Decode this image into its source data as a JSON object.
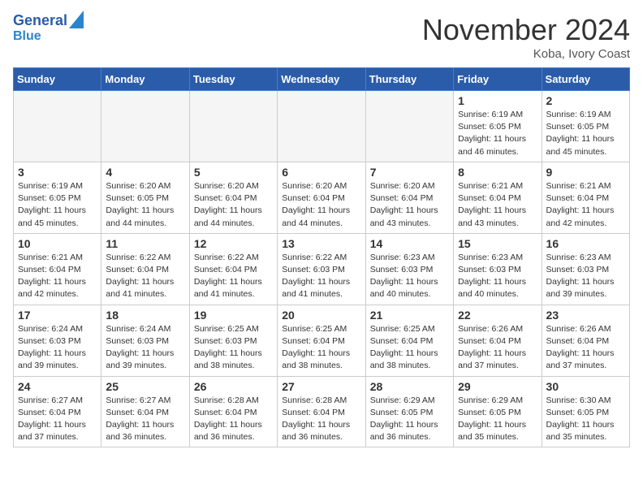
{
  "header": {
    "logo_line1": "General",
    "logo_line2": "Blue",
    "month": "November 2024",
    "location": "Koba, Ivory Coast"
  },
  "weekdays": [
    "Sunday",
    "Monday",
    "Tuesday",
    "Wednesday",
    "Thursday",
    "Friday",
    "Saturday"
  ],
  "weeks": [
    [
      {
        "day": "",
        "info": ""
      },
      {
        "day": "",
        "info": ""
      },
      {
        "day": "",
        "info": ""
      },
      {
        "day": "",
        "info": ""
      },
      {
        "day": "",
        "info": ""
      },
      {
        "day": "1",
        "info": "Sunrise: 6:19 AM\nSunset: 6:05 PM\nDaylight: 11 hours\nand 46 minutes."
      },
      {
        "day": "2",
        "info": "Sunrise: 6:19 AM\nSunset: 6:05 PM\nDaylight: 11 hours\nand 45 minutes."
      }
    ],
    [
      {
        "day": "3",
        "info": "Sunrise: 6:19 AM\nSunset: 6:05 PM\nDaylight: 11 hours\nand 45 minutes."
      },
      {
        "day": "4",
        "info": "Sunrise: 6:20 AM\nSunset: 6:05 PM\nDaylight: 11 hours\nand 44 minutes."
      },
      {
        "day": "5",
        "info": "Sunrise: 6:20 AM\nSunset: 6:04 PM\nDaylight: 11 hours\nand 44 minutes."
      },
      {
        "day": "6",
        "info": "Sunrise: 6:20 AM\nSunset: 6:04 PM\nDaylight: 11 hours\nand 44 minutes."
      },
      {
        "day": "7",
        "info": "Sunrise: 6:20 AM\nSunset: 6:04 PM\nDaylight: 11 hours\nand 43 minutes."
      },
      {
        "day": "8",
        "info": "Sunrise: 6:21 AM\nSunset: 6:04 PM\nDaylight: 11 hours\nand 43 minutes."
      },
      {
        "day": "9",
        "info": "Sunrise: 6:21 AM\nSunset: 6:04 PM\nDaylight: 11 hours\nand 42 minutes."
      }
    ],
    [
      {
        "day": "10",
        "info": "Sunrise: 6:21 AM\nSunset: 6:04 PM\nDaylight: 11 hours\nand 42 minutes."
      },
      {
        "day": "11",
        "info": "Sunrise: 6:22 AM\nSunset: 6:04 PM\nDaylight: 11 hours\nand 41 minutes."
      },
      {
        "day": "12",
        "info": "Sunrise: 6:22 AM\nSunset: 6:04 PM\nDaylight: 11 hours\nand 41 minutes."
      },
      {
        "day": "13",
        "info": "Sunrise: 6:22 AM\nSunset: 6:03 PM\nDaylight: 11 hours\nand 41 minutes."
      },
      {
        "day": "14",
        "info": "Sunrise: 6:23 AM\nSunset: 6:03 PM\nDaylight: 11 hours\nand 40 minutes."
      },
      {
        "day": "15",
        "info": "Sunrise: 6:23 AM\nSunset: 6:03 PM\nDaylight: 11 hours\nand 40 minutes."
      },
      {
        "day": "16",
        "info": "Sunrise: 6:23 AM\nSunset: 6:03 PM\nDaylight: 11 hours\nand 39 minutes."
      }
    ],
    [
      {
        "day": "17",
        "info": "Sunrise: 6:24 AM\nSunset: 6:03 PM\nDaylight: 11 hours\nand 39 minutes."
      },
      {
        "day": "18",
        "info": "Sunrise: 6:24 AM\nSunset: 6:03 PM\nDaylight: 11 hours\nand 39 minutes."
      },
      {
        "day": "19",
        "info": "Sunrise: 6:25 AM\nSunset: 6:03 PM\nDaylight: 11 hours\nand 38 minutes."
      },
      {
        "day": "20",
        "info": "Sunrise: 6:25 AM\nSunset: 6:04 PM\nDaylight: 11 hours\nand 38 minutes."
      },
      {
        "day": "21",
        "info": "Sunrise: 6:25 AM\nSunset: 6:04 PM\nDaylight: 11 hours\nand 38 minutes."
      },
      {
        "day": "22",
        "info": "Sunrise: 6:26 AM\nSunset: 6:04 PM\nDaylight: 11 hours\nand 37 minutes."
      },
      {
        "day": "23",
        "info": "Sunrise: 6:26 AM\nSunset: 6:04 PM\nDaylight: 11 hours\nand 37 minutes."
      }
    ],
    [
      {
        "day": "24",
        "info": "Sunrise: 6:27 AM\nSunset: 6:04 PM\nDaylight: 11 hours\nand 37 minutes."
      },
      {
        "day": "25",
        "info": "Sunrise: 6:27 AM\nSunset: 6:04 PM\nDaylight: 11 hours\nand 36 minutes."
      },
      {
        "day": "26",
        "info": "Sunrise: 6:28 AM\nSunset: 6:04 PM\nDaylight: 11 hours\nand 36 minutes."
      },
      {
        "day": "27",
        "info": "Sunrise: 6:28 AM\nSunset: 6:04 PM\nDaylight: 11 hours\nand 36 minutes."
      },
      {
        "day": "28",
        "info": "Sunrise: 6:29 AM\nSunset: 6:05 PM\nDaylight: 11 hours\nand 36 minutes."
      },
      {
        "day": "29",
        "info": "Sunrise: 6:29 AM\nSunset: 6:05 PM\nDaylight: 11 hours\nand 35 minutes."
      },
      {
        "day": "30",
        "info": "Sunrise: 6:30 AM\nSunset: 6:05 PM\nDaylight: 11 hours\nand 35 minutes."
      }
    ]
  ]
}
